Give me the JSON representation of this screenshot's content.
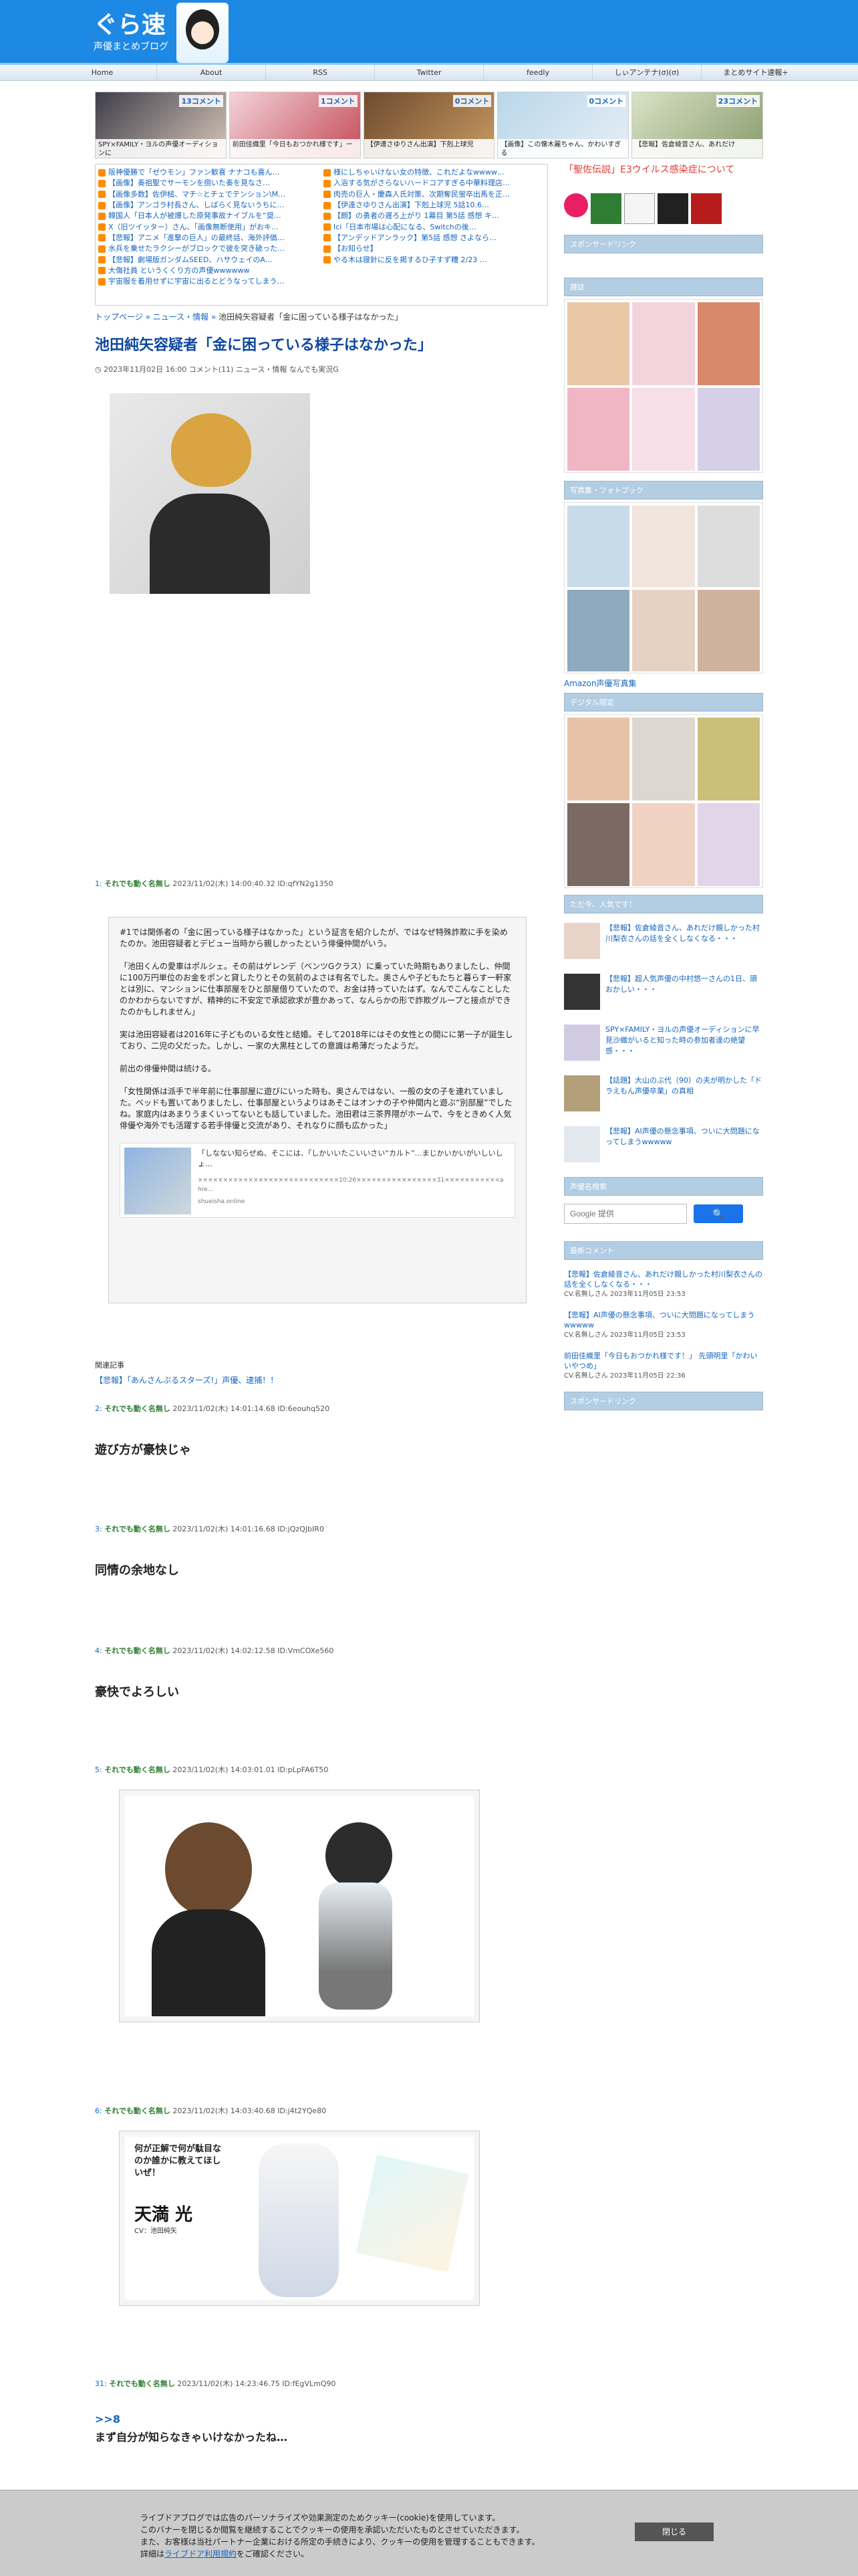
{
  "site": {
    "logo": "ぐら速",
    "logo_sub": "声優まとめブログ"
  },
  "nav": [
    "Home",
    "About",
    "RSS",
    "Twitter",
    "feedly",
    "しぃアンテナ(σ)(σ)",
    "まとめサイト速報+"
  ],
  "ranking": [
    {
      "count": "13コメント",
      "title": "SPY×FAMILY・ヨルの声優オーディションに"
    },
    {
      "count": "1コメント",
      "title": "前田佳織里「今日もおつかれ様です」ー"
    },
    {
      "count": "0コメント",
      "title": "【伊達さゆりさん出演】下剋上球児"
    },
    {
      "count": "0コメント",
      "title": "【画像】この懐木麗ちゃん、かわいすぎる"
    },
    {
      "count": "23コメント",
      "title": "【悲報】佐倉綾音さん、あれだけ"
    }
  ],
  "links_left": [
    "阪神優勝で「ゼウモン」ファン歓喜 ナナコも喜ん…",
    "【画像】奏祖聖でサーモンを捌いた奏を見なさ…",
    "【画像多数】佐伊槌、マチ☆とチェでテンション\\M…",
    "【画像】アンゴラ村長さん、しばらく見ないうちに…",
    "韓国人「日本人が被爆した原発事故ナイブルを“奨…",
    "X（旧ツイッター）さん、「画像無断使用」がおキ…",
    "【悲報】アニメ「進撃の巨人」の最終話、海外評価…",
    "水兵を乗せたラクシーがブロックで彼を突き破った…",
    "【悲報】劇場版ガンダムSEED、ハサウェイのA…",
    "大傷社員 というくくり方の声優wwwwww",
    "宇宙服を着用せずに宇宙に出るとどうなってしまう…"
  ],
  "links_right": [
    "様にしちゃいけない女の特徴、これだよなwwww…",
    "入浴する気がさらないハードコアすぎる中華料理店…",
    "肉売の巨人・慶森人氏対策、次期奪民蛍卒出馬を正…",
    "【伊達さゆりさん出演】下剋上球児 5話10.6…",
    "【朗】の勇者の遅ろ上がり 1幕目 第5話 感想 キ…",
    "Ici「日本市場は心配になる、Switchの後…",
    "【アンデッドアンラック】第5話 感想 さよなら…",
    "【お知らせ】",
    "やる木は寝針に反を掲するひ子すず糟 2/23 …",
    "",
    ""
  ],
  "breadcrumb": {
    "home": "トップページ",
    "cat": "ニュース・情報",
    "current": "池田純矢容疑者「金に困っている様子はなかった」"
  },
  "article": {
    "title": "池田純矢容疑者「金に困っている様子はなかった」",
    "meta": "2023年11月02日 16:00 コメント(11)   ニュース・情報  なんでも実況G"
  },
  "comments": [
    {
      "num": "1:",
      "name": "それでも動く名無し",
      "date": "2023/11/02(木) 14:00:40.32 ID:qfYN2g1350"
    },
    {
      "num": "2:",
      "name": "それでも動く名無し",
      "date": "2023/11/02(木) 14:01:14.68 ID:6eouhq520",
      "body": "遊び方が豪快じゃ"
    },
    {
      "num": "3:",
      "name": "それでも動く名無し",
      "date": "2023/11/02(木) 14:01:16.68 ID:jQzQJbIR0",
      "body": "同情の余地なし"
    },
    {
      "num": "4:",
      "name": "それでも動く名無し",
      "date": "2023/11/02(木) 14:02:12.58 ID:VmCOXe560",
      "body": "豪快でよろしい"
    },
    {
      "num": "5:",
      "name": "それでも動く名無し",
      "date": "2023/11/02(木) 14:03:01.01 ID:pLpFA6T50"
    },
    {
      "num": "6:",
      "name": "それでも動く名無し",
      "date": "2023/11/02(木) 14:03:40.68 ID:j4t2YQe80"
    },
    {
      "num": "31:",
      "name": "それでも動く名無し",
      "date": "2023/11/02(木) 14:23:46.75 ID:fEgVLmQ90",
      "anchor": ">>8",
      "body": "まず自分が知らなきゃいけなかったね…"
    }
  ],
  "quote": {
    "p1": "#1では関係者の「金に困っている様子はなかった」という証言を紹介したが、ではなぜ特殊詐欺に手を染めたのか。池田容疑者とデビュー当時から親しかったという俳優仲間がいう。",
    "p2": "「池田くんの愛車はポルシェ。その前はゲレンデ（ベンツGクラス）に乗っていた時期もありましたし、仲間に100万円単位のお金をポンと貸したりとその気前のよさは有名でした。奥さんや子どもたちと暮らす一軒家とは別に、マンションに仕事部屋をひと部屋借りていたので、お金は持っていたはず。なんでこんなことしたのかわからないですが、精神的に不安定で承認欲求が豊かあって、なんらかの形で詐欺グループと接点ができたのかもしれません」",
    "p3": "実は池田容疑者は2016年に子どものいる女性と結婚。そして2018年にはその女性との間にに第一子が誕生しており、二児の父だった。しかし、一家の大黒柱としての意識は希薄だったようだ。",
    "p4": "前出の俳優仲間は続ける。",
    "p5": "「女性関係は派手で半年前に仕事部屋に遊びにいった時も、奥さんではない、一般の女の子を連れていました。ベッドも置いてありましたし、仕事部屋というよりはあそこはオンナの子や仲間内と遊ぶ“別部屋”でしたね。家庭内はあまりうまくいってないとも話していました。池田君は三茶界隈がホームで、今をときめく人気俳優や海外でも活躍する若手俳優と交流があり、それなりに顔も広かった」",
    "embed_title": "「しなない知らぜぬ、そこには、「しかいいたこいいさい“カルト”…まじかいかいがいしいしょ…",
    "embed_desc": "××××××××××××××××××××××××××××10:26××××××××××××××××31××××××××××<a hre…",
    "embed_site": "shueisha.online"
  },
  "related": {
    "label": "関連記事",
    "link": "【悲報】「あんさんぶるスターズ!」声優、逮捕！！"
  },
  "card": {
    "name": "天満 光",
    "cv": "CV：池田純矢",
    "lead": "何が正解で何が駄目なのか誰かに教えてほしいぜ！"
  },
  "sidebar": {
    "notice": "「聖佐伝説」E3ウイルス感染症について",
    "sponsored": "スポンサードリンク",
    "magazine": "雑誌",
    "photobook": "写真集・フォトブック",
    "amazon_link": "Amazon声優写真集",
    "digital": "デジタル限定",
    "popular": "ただ今、人気です！",
    "popular_items": [
      "【悲報】佐倉綾音さん、あれだけ親しかった村川梨衣さんの話を全くしなくなる・・・",
      "【悲報】超人気声優の中村悠一さんの1日、頭おかしい・・・",
      "SPY×FAMILY・ヨルの声優オーディションに早見沙織がいると知った時の参加者達の絶望感・・・",
      "【話題】大山のぶ代（90）の夫が明かした「ドラえもん声優卒業」の真相",
      "【悲報】AI声優の懸念事項、ついに大問題になってしまうwwwww"
    ],
    "search_head": "声優名検索",
    "search_placeholder": "Google 提供",
    "search_button": "🔍",
    "recent_head": "最新コメント",
    "recent": [
      {
        "title": "【悲報】佐倉綾音さん、あれだけ親しかった村川梨衣さんの話を全くしなくなる・・・",
        "meta": "CV.名無しさん  2023年11月05日 23:53"
      },
      {
        "title": "【悲報】AI声優の懸念事項、ついに大問題になってしまうwwwww",
        "meta": "CV.名無しさん  2023年11月05日 23:53"
      },
      {
        "title": "前田佳織里「今日もおつかれ様です！」 先頭明里「かわいいやつめ」",
        "meta": "CV.名無しさん  2023年11月05日 22:36"
      }
    ]
  },
  "cookie": {
    "l1": "ライブドアブログでは広告のパーソナライズや効果測定のためクッキー(cookie)を使用しています。",
    "l2": "このバナーを閉じるか閲覧を継続することでクッキーの使用を承認いただいたものとさせていただきます。",
    "l3": "また、お客様は当社パートナー企業における所定の手続きにより、クッキーの使用を管理することもできます。",
    "l4a": "詳細は",
    "l4link": "ライブドア利用規約",
    "l4b": "をご確認ください。",
    "button": "閉じる"
  },
  "colors": {
    "header": "#1e88e5",
    "link": "#1565c0",
    "name": "#2e7d32",
    "title": "#0d47a1"
  }
}
